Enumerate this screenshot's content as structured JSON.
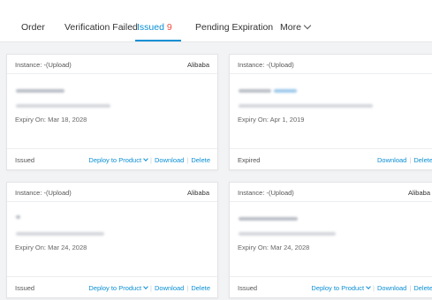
{
  "tabs": [
    {
      "label": "Order"
    },
    {
      "label": "Verification Failed"
    },
    {
      "label": "Issued",
      "count": "9"
    },
    {
      "label": "Pending Expiration"
    },
    {
      "label": "More"
    }
  ],
  "cards": [
    {
      "instance": "Instance: -(Upload)",
      "brand": "Alibaba",
      "expiry": "Expiry On:  Mar 18, 2028",
      "status": "Issued",
      "deploy": "Deploy to Product",
      "download": "Download",
      "delete": "Delete"
    },
    {
      "instance": "Instance: -(Upload)",
      "brand": "",
      "expiry": "Expiry On:  Apr 1, 2019",
      "status": "Expired",
      "download": "Download",
      "delete": "Delete"
    },
    {
      "instance": "Instance: -(Upload)",
      "brand": "Alibaba",
      "expiry": "Expiry On:  Mar 24, 2028",
      "status": "Issued",
      "deploy": "Deploy to Product",
      "download": "Download",
      "delete": "Delete"
    },
    {
      "instance": "Instance: -(Upload)",
      "brand": "Alibaba",
      "expiry": "Expiry On:  Mar 24, 2028",
      "status": "Issued",
      "deploy": "Deploy to Product",
      "download": "Download",
      "delete": "Delete"
    }
  ],
  "colors": {
    "accent": "#0a8fd4",
    "count": "#f24d3d"
  }
}
